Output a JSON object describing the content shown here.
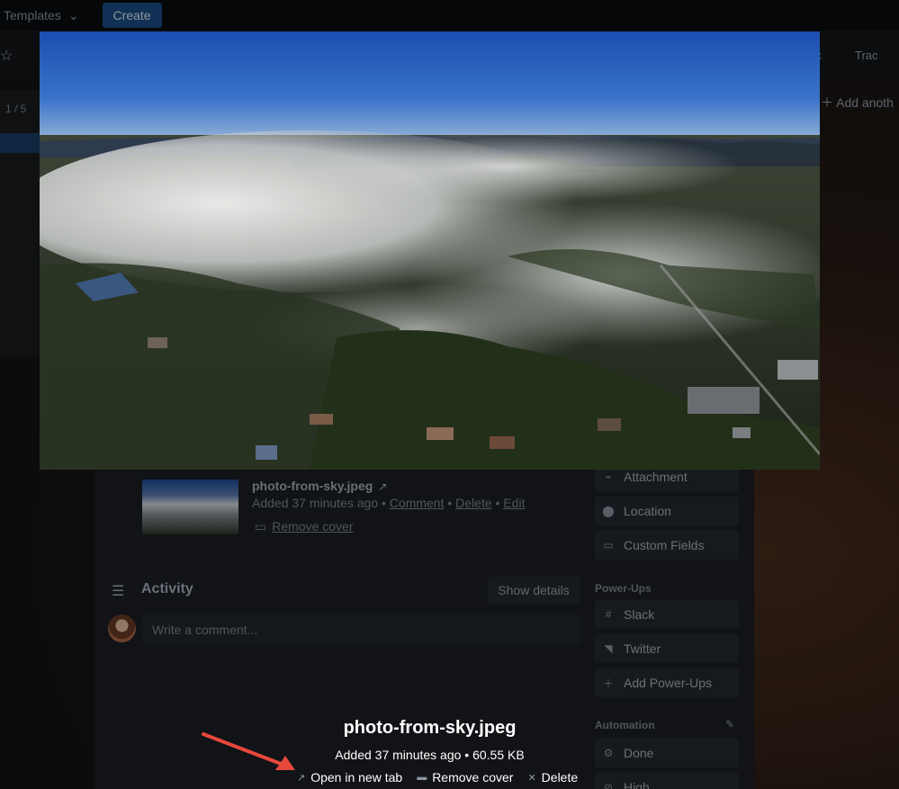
{
  "topbar": {
    "templates_label": "Templates",
    "create_label": "Create"
  },
  "boardbar": {
    "partial_right_1": "ck",
    "partial_right_2": "Trac"
  },
  "board": {
    "add_another_label": "Add anoth",
    "left_fraction": "1 / 5"
  },
  "card": {
    "attachment": {
      "name": "photo-from-sky.jpeg",
      "ext_icon": "↗",
      "added": "Added 37 minutes ago",
      "sep": "•",
      "comment_link": "Comment",
      "delete_link": "Delete",
      "edit_link": "Edit",
      "remove_cover": "Remove cover"
    },
    "activity": {
      "title": "Activity",
      "show_details": "Show details",
      "comment_placeholder": "Write a comment..."
    },
    "sidebar": {
      "buttons": [
        {
          "label": "Attachment",
          "icon": "paperclip-icon"
        },
        {
          "label": "Location",
          "icon": "location-pin-icon"
        },
        {
          "label": "Custom Fields",
          "icon": "custom-fields-icon"
        }
      ],
      "powerups_heading": "Power-Ups",
      "powerups": [
        {
          "label": "Slack",
          "icon": "slack-icon"
        },
        {
          "label": "Twitter",
          "icon": "twitter-icon"
        },
        {
          "label": "Add Power-Ups",
          "icon": "plus-icon"
        }
      ],
      "automation_heading": "Automation",
      "automation": [
        {
          "label": "Done",
          "icon": "gears-icon"
        },
        {
          "label": "High",
          "icon": "no-entry-icon"
        }
      ]
    }
  },
  "viewer": {
    "title": "photo-from-sky.jpeg",
    "meta": "Added 37 minutes ago • 60.55 KB",
    "open_new_tab": "Open in new tab",
    "remove_cover": "Remove cover",
    "delete": "Delete"
  },
  "colors": {
    "annotation_arrow": "#e8483c",
    "sky_top": "#1b4fb0",
    "accent_button": "#1a4f8a"
  }
}
